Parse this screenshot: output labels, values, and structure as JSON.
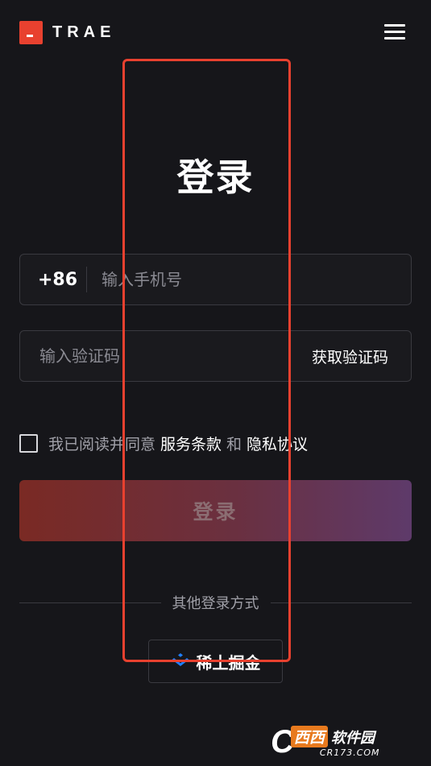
{
  "header": {
    "logo_text": "TRAE",
    "menu_icon": "hamburger-menu-icon",
    "accent_color": "#e8412f"
  },
  "login": {
    "title": "登录",
    "country_code": "+86",
    "phone_placeholder": "输入手机号",
    "code_placeholder": "输入验证码",
    "get_code_label": "获取验证码",
    "agree_prefix": "我已阅读并同意",
    "terms_label": "服务条款",
    "and_text": "和",
    "privacy_label": "隐私协议",
    "submit_label": "登录"
  },
  "other_login": {
    "label": "其他登录方式",
    "providers": [
      {
        "name": "稀土掘金",
        "icon": "juejin-logo-icon"
      }
    ]
  },
  "watermark": {
    "letter": "C",
    "brand": "西西",
    "suffix": "软件园",
    "domain": "CR173.COM"
  }
}
